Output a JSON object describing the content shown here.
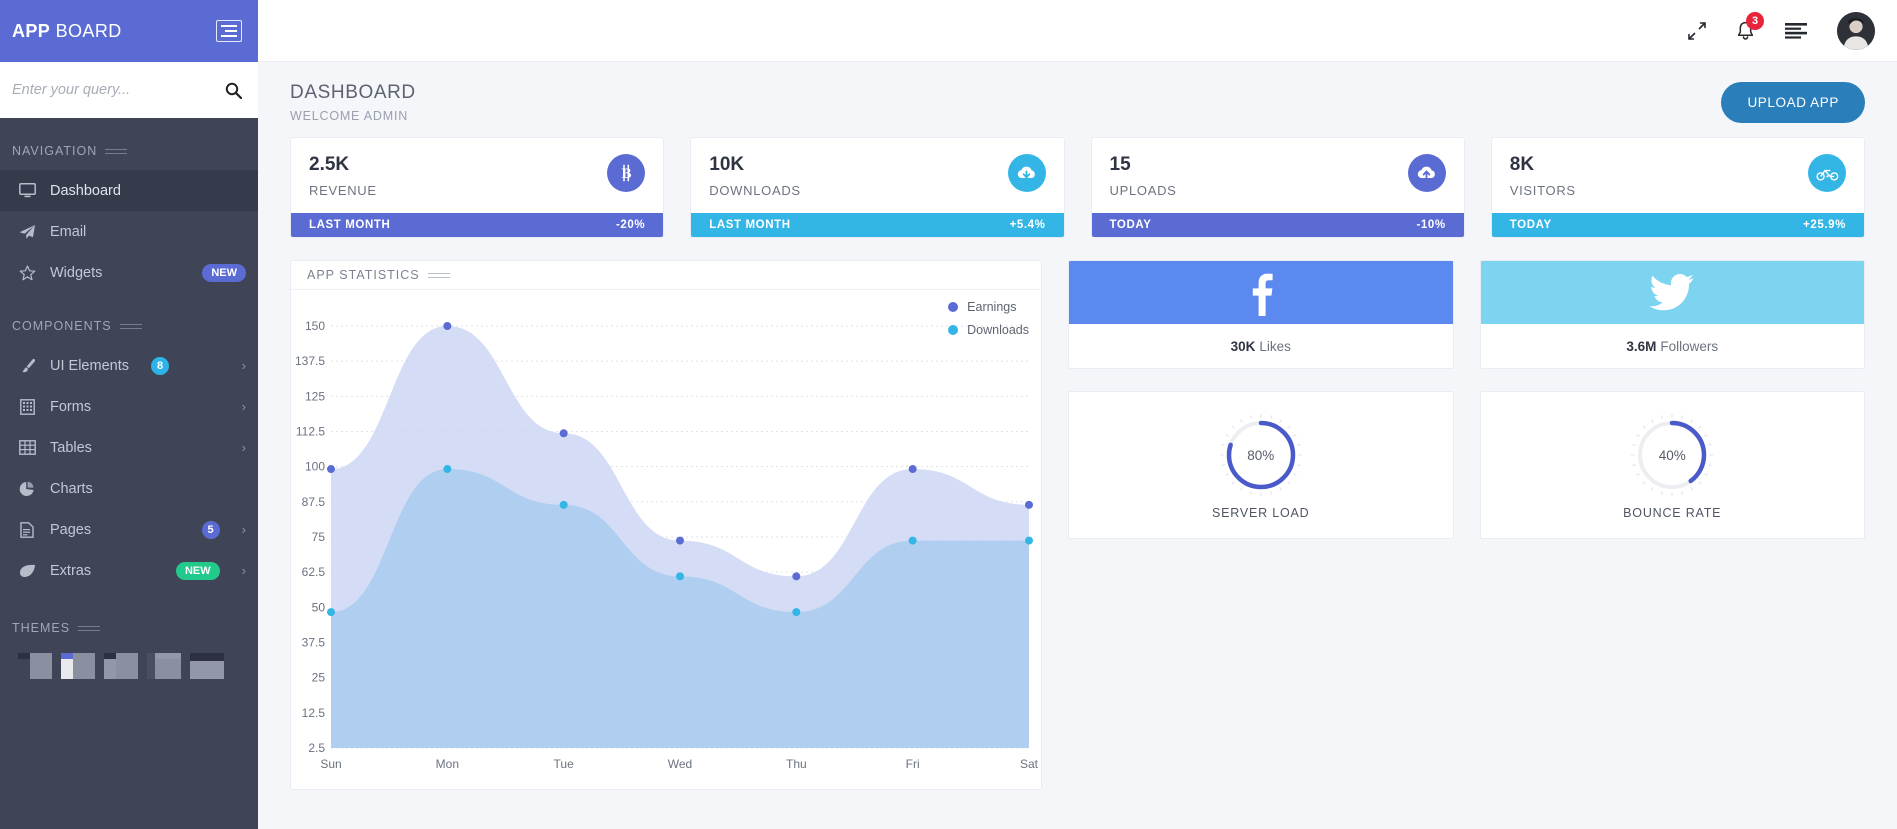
{
  "brand": {
    "bold": "APP",
    "light": " BOARD",
    "menu_icon": "hamburger-icon"
  },
  "search": {
    "placeholder": "Enter your query...",
    "value": "",
    "icon": "search-icon"
  },
  "sidebar": {
    "sections": [
      {
        "title": "NAVIGATION"
      },
      {
        "title": "COMPONENTS"
      },
      {
        "title": "THEMES"
      }
    ],
    "nav_items": [
      {
        "label": "Dashboard",
        "icon": "desktop-icon",
        "active": true,
        "badge": "",
        "chevron": false
      },
      {
        "label": "Email",
        "icon": "paper-plane-icon",
        "active": false,
        "badge": "",
        "chevron": false
      },
      {
        "label": "Widgets",
        "icon": "star-icon",
        "active": false,
        "badge": "NEW",
        "badge_style": "pill-new-blue",
        "chevron": false
      }
    ],
    "component_items": [
      {
        "label": "UI Elements",
        "icon": "brush-icon",
        "badge": "8",
        "badge_style": "count-cyan",
        "badge_inline": true,
        "chevron": true
      },
      {
        "label": "Forms",
        "icon": "form-icon",
        "badge": "",
        "chevron": true
      },
      {
        "label": "Tables",
        "icon": "table-icon",
        "badge": "",
        "chevron": true
      },
      {
        "label": "Charts",
        "icon": "pie-chart-icon",
        "badge": "",
        "chevron": false
      },
      {
        "label": "Pages",
        "icon": "file-icon",
        "badge": "5",
        "badge_style": "count-indigo",
        "chevron": true
      },
      {
        "label": "Extras",
        "icon": "leaf-icon",
        "badge": "NEW",
        "badge_style": "pill-new-green",
        "chevron": true
      }
    ],
    "themes": [
      {
        "name": "theme-swatch-1"
      },
      {
        "name": "theme-swatch-2"
      },
      {
        "name": "theme-swatch-3"
      },
      {
        "name": "theme-swatch-4"
      },
      {
        "name": "theme-swatch-5"
      }
    ]
  },
  "topbar": {
    "expand_icon": "expand-arrows-icon",
    "bell_icon": "bell-icon",
    "notification_count": "3",
    "list_icon": "list-lines-icon",
    "avatar": "user-avatar"
  },
  "page": {
    "title": "DASHBOARD",
    "subtitle": "WELCOME ADMIN",
    "upload_label": "UPLOAD APP"
  },
  "kpis": [
    {
      "value": "2.5K",
      "label": "REVENUE",
      "icon": "bitcoin-icon",
      "icon_bg": "#5b6bd4",
      "foot_label": "LAST MONTH",
      "foot_value": "-20%",
      "foot_bg": "#5b6bd4"
    },
    {
      "value": "10K",
      "label": "DOWNLOADS",
      "icon": "cloud-download-icon",
      "icon_bg": "#33b5e5",
      "foot_label": "LAST MONTH",
      "foot_value": "+5.4%",
      "foot_bg": "#33b5e5"
    },
    {
      "value": "15",
      "label": "UPLOADS",
      "icon": "cloud-upload-icon",
      "icon_bg": "#5b6bd4",
      "foot_label": "TODAY",
      "foot_value": "-10%",
      "foot_bg": "#5b6bd4"
    },
    {
      "value": "8K",
      "label": "VISITORS",
      "icon": "bicycle-icon",
      "icon_bg": "#33b5e5",
      "foot_label": "TODAY",
      "foot_value": "+25.9%",
      "foot_bg": "#33b5e5"
    }
  ],
  "chart_card": {
    "title": "APP STATISTICS"
  },
  "chart_data": {
    "type": "area",
    "title": "APP STATISTICS",
    "xlabel": "",
    "ylabel": "",
    "grid": true,
    "legend_position": "top-right",
    "categories": [
      "Sun",
      "Mon",
      "Tue",
      "Wed",
      "Thu",
      "Fri",
      "Sat"
    ],
    "ytick_labels": [
      "150",
      "137.5",
      "125",
      "112.5",
      "100",
      "87.5",
      "75",
      "62.5",
      "50",
      "37.5",
      "25",
      "12.5",
      "2.5"
    ],
    "ylim": [
      0,
      150
    ],
    "series": [
      {
        "name": "Earnings",
        "color": "#5b6bd4",
        "fill": "#ccd6f5",
        "values": [
          100,
          150,
          112.5,
          75,
          62.5,
          100,
          87.5
        ]
      },
      {
        "name": "Downloads",
        "color": "#33b5e5",
        "fill": "#a9cdee",
        "values": [
          50,
          100,
          87.5,
          62.5,
          50,
          75,
          75
        ]
      }
    ]
  },
  "social": [
    {
      "network": "facebook-icon",
      "bg": "#5b89ef",
      "count": "30K",
      "unit": "Likes"
    },
    {
      "network": "twitter-icon",
      "bg": "#7dd4f0",
      "count": "3.6M",
      "unit": "Followers"
    }
  ],
  "gauges": [
    {
      "label": "SERVER LOAD",
      "value": "80%",
      "percent": 80,
      "color": "#4a5ac8"
    },
    {
      "label": "BOUNCE RATE",
      "value": "40%",
      "percent": 40,
      "color": "#4a5ac8"
    }
  ]
}
